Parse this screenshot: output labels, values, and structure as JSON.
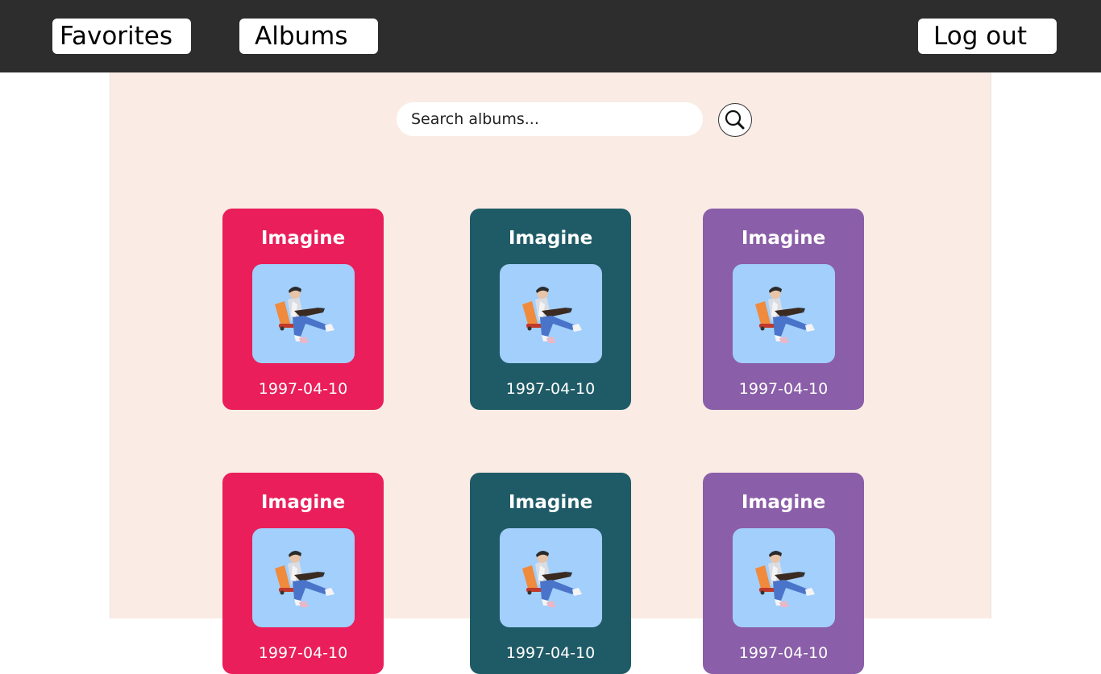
{
  "nav": {
    "favorites_label": "Favorites",
    "albums_label": "Albums",
    "logout_label": "Log out"
  },
  "search": {
    "placeholder": "Search albums...",
    "icon": "search-icon"
  },
  "colors": {
    "topbar": "#2d2d2d",
    "content_bg": "#faece4",
    "cover_bg": "#a2cffc",
    "card_red": "#e91e5a",
    "card_teal": "#1f5b66",
    "card_purple": "#8a5ea8"
  },
  "albums": [
    {
      "title": "Imagine",
      "date": "1997-04-10",
      "color": "#e91e5a"
    },
    {
      "title": "Imagine",
      "date": "1997-04-10",
      "color": "#1f5b66"
    },
    {
      "title": "Imagine",
      "date": "1997-04-10",
      "color": "#8a5ea8"
    },
    {
      "title": "Imagine",
      "date": "1997-04-10",
      "color": "#e91e5a"
    },
    {
      "title": "Imagine",
      "date": "1997-04-10",
      "color": "#1f5b66"
    },
    {
      "title": "Imagine",
      "date": "1997-04-10",
      "color": "#8a5ea8"
    }
  ]
}
